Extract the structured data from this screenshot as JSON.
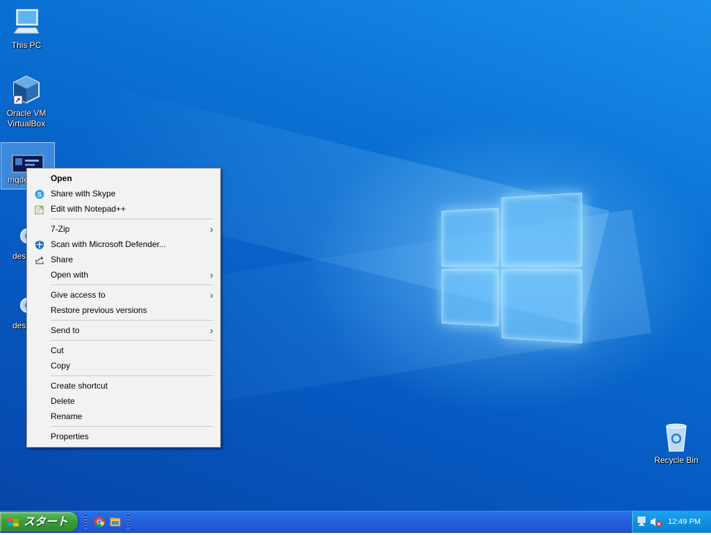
{
  "desktop": {
    "icons": [
      {
        "label": "This PC"
      },
      {
        "label_line1": "Oracle VM",
        "label_line2": "VirtualBox"
      },
      {
        "label": "mqde"
      },
      {
        "label": "desk"
      },
      {
        "label": "desk"
      },
      {
        "label": "Recycle Bin"
      }
    ]
  },
  "context_menu": {
    "open": "Open",
    "share_skype": "Share with Skype",
    "edit_notepad": "Edit with Notepad++",
    "zip": "7-Zip",
    "scan_defender": "Scan with Microsoft Defender...",
    "share": "Share",
    "open_with": "Open with",
    "give_access": "Give access to",
    "restore_versions": "Restore previous versions",
    "send_to": "Send to",
    "cut": "Cut",
    "copy": "Copy",
    "create_shortcut": "Create shortcut",
    "delete": "Delete",
    "rename": "Rename",
    "properties": "Properties",
    "submenu_arrow": "›"
  },
  "taskbar": {
    "start_label": "スタート",
    "clock": "12:49 PM"
  },
  "colors": {
    "desktop_blue": "#0a6fd2",
    "taskbar_blue": "#245edb",
    "start_green": "#3c9d3c",
    "tray_blue": "#1290e0"
  }
}
